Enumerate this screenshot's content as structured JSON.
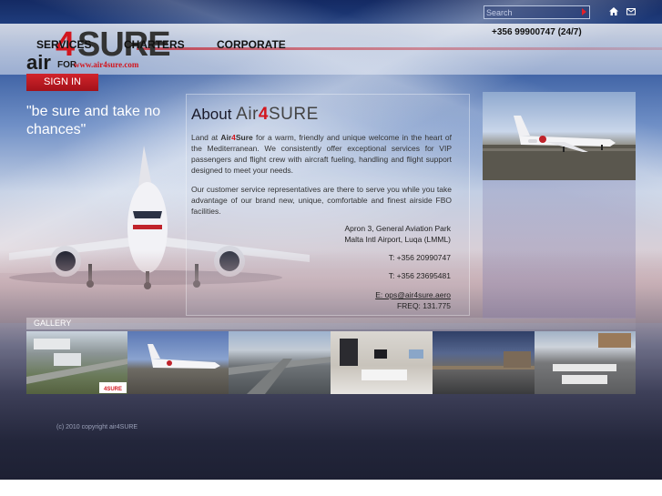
{
  "header": {
    "logo": {
      "air": "air",
      "four": "4",
      "sure": "SURE",
      "for": "FOR",
      "url": "www.air4sure.com"
    },
    "nav": [
      "SERVICES",
      "CHARTERS",
      "CORPORATE"
    ],
    "phone": "+356 99900747 (24/7)",
    "search": {
      "placeholder": "Search"
    },
    "icons": [
      "home-icon",
      "mail-icon"
    ],
    "signin": "SIGN IN"
  },
  "tagline": "\"be sure and take no chances\"",
  "about": {
    "title_prefix": "About",
    "brand_a": "Air",
    "brand_4": "4",
    "brand_b": "SURE",
    "p1_lead": "Land at ",
    "p1_brand_a": "Air",
    "p1_brand_4": "4",
    "p1_brand_b": "Sure",
    "p1_rest": " for a warm, friendly and unique welcome in the heart of the Mediterranean.  We consistently offer exceptional services for VIP passengers and flight crew with aircraft fueling, handling and flight support designed to meet your needs.",
    "p2": "Our customer service representatives are there to serve you while you take advantage of our brand new, unique, comfortable and finest airside FBO facilities.",
    "address1": "Apron 3, General Aviation Park",
    "address2": "Malta Intl Airport, Luqa (LMML)",
    "tel1": "T: +356 20990747",
    "tel2": "T: +356 23695481",
    "email": "E: ops@air4sure.aero",
    "freq": "FREQ: 131.775"
  },
  "gallery": {
    "label": "GALLERY",
    "thumbs": [
      "gallery-thumb-aerial",
      "gallery-thumb-jet",
      "gallery-thumb-airfield",
      "gallery-thumb-lounge",
      "gallery-thumb-dusk",
      "gallery-thumb-apron"
    ],
    "thumb4_logo": "4SURE"
  },
  "footer": {
    "copyright": "(c) 2010 copyright air4SURE"
  },
  "colors": {
    "accent_red": "#d2161e",
    "nav_text": "#111111",
    "bg_dark": "#1d2033"
  }
}
